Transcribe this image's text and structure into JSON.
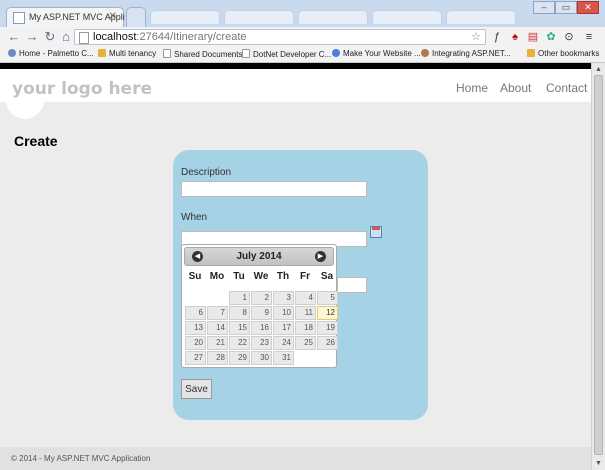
{
  "browser": {
    "active_tab_title": "My ASP.NET MVC Appli",
    "url_host": "localhost",
    "url_path": ":27644/Itinerary/create",
    "bookmarks": [
      "Home - Palmetto C...",
      "Multi tenancy",
      "Shared Documents",
      "DotNet Developer C...",
      "Make Your Website ...",
      "Integrating ASP.NET...",
      "Other bookmarks"
    ]
  },
  "site": {
    "logo": "your logo here",
    "nav": [
      "Home",
      "About",
      "Contact"
    ],
    "page_title": "Create",
    "footer": "© 2014 - My ASP.NET MVC Application"
  },
  "form": {
    "description_label": "Description",
    "description_value": "",
    "when_label": "When",
    "when_value": "",
    "save_label": "Save"
  },
  "datepicker": {
    "title": "July 2014",
    "weekdays": [
      "Su",
      "Mo",
      "Tu",
      "We",
      "Th",
      "Fr",
      "Sa"
    ],
    "days": [
      1,
      2,
      3,
      4,
      5,
      6,
      7,
      8,
      9,
      10,
      11,
      12,
      13,
      14,
      15,
      16,
      17,
      18,
      19,
      20,
      21,
      22,
      23,
      24,
      25,
      26,
      27,
      28,
      29,
      30,
      31
    ],
    "first_weekday_index": 2,
    "today": 12
  }
}
